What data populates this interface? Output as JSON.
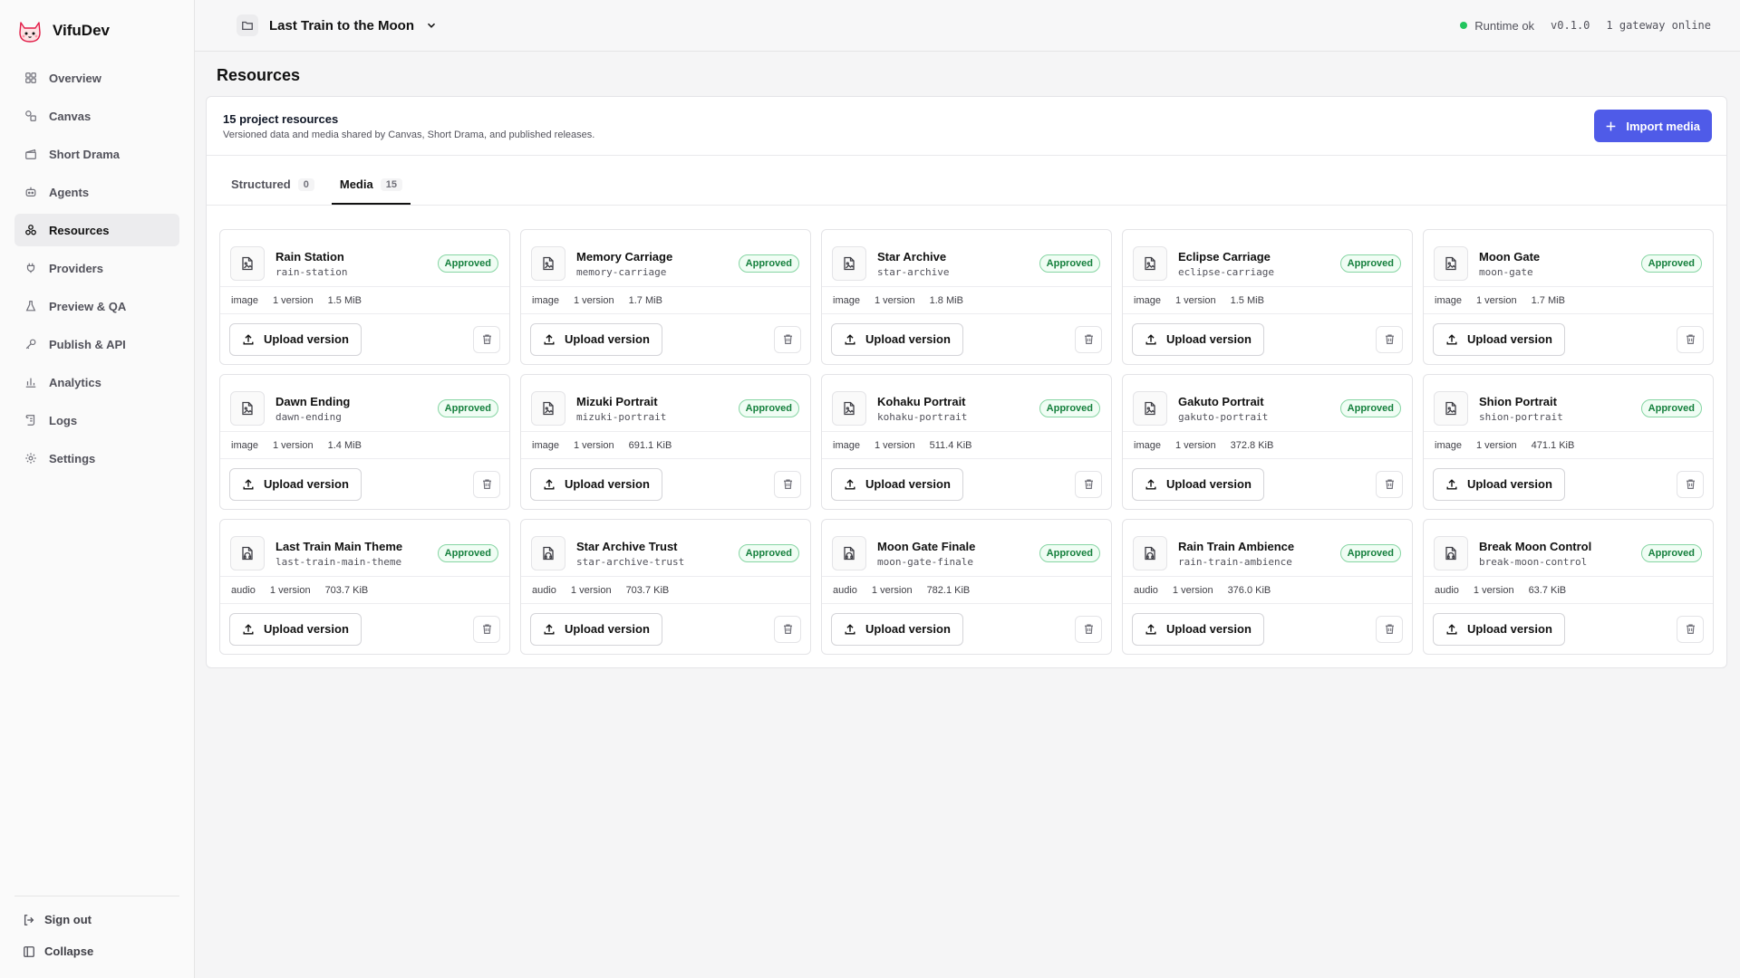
{
  "app": {
    "name": "VifuDev",
    "logo_icon": "cat-logo-icon"
  },
  "sidebar": {
    "items": [
      {
        "label": "Overview",
        "icon": "grid-icon",
        "active": false
      },
      {
        "label": "Canvas",
        "icon": "shapes-icon",
        "active": false
      },
      {
        "label": "Short Drama",
        "icon": "clapperboard-icon",
        "active": false
      },
      {
        "label": "Agents",
        "icon": "bot-icon",
        "active": false
      },
      {
        "label": "Resources",
        "icon": "boxes-icon",
        "active": true
      },
      {
        "label": "Providers",
        "icon": "plug-icon",
        "active": false
      },
      {
        "label": "Preview & QA",
        "icon": "flask-icon",
        "active": false
      },
      {
        "label": "Publish & API",
        "icon": "key-icon",
        "active": false
      },
      {
        "label": "Analytics",
        "icon": "bar-chart-icon",
        "active": false
      },
      {
        "label": "Logs",
        "icon": "scroll-icon",
        "active": false
      },
      {
        "label": "Settings",
        "icon": "gear-icon",
        "active": false
      }
    ],
    "sign_out": "Sign out",
    "collapse": "Collapse"
  },
  "header": {
    "project_name": "Last Train to the Moon",
    "runtime_status": "Runtime ok",
    "version": "v0.1.0",
    "gateway": "1 gateway online",
    "status_color": "#22c55e"
  },
  "page": {
    "title": "Resources",
    "panel_title": "15 project resources",
    "panel_subtitle": "Versioned data and media shared by Canvas, Short Drama, and published releases.",
    "import_button": "Import media",
    "accent_color": "#4f5be8",
    "tabs": [
      {
        "label": "Structured",
        "count": "0",
        "active": false
      },
      {
        "label": "Media",
        "count": "15",
        "active": true
      }
    ]
  },
  "resources": [
    {
      "name": "Rain Station",
      "slug": "rain-station",
      "status": "Approved",
      "type": "image",
      "versions": "1 version",
      "size": "1.5 MiB"
    },
    {
      "name": "Memory Carriage",
      "slug": "memory-carriage",
      "status": "Approved",
      "type": "image",
      "versions": "1 version",
      "size": "1.7 MiB"
    },
    {
      "name": "Star Archive",
      "slug": "star-archive",
      "status": "Approved",
      "type": "image",
      "versions": "1 version",
      "size": "1.8 MiB"
    },
    {
      "name": "Eclipse Carriage",
      "slug": "eclipse-carriage",
      "status": "Approved",
      "type": "image",
      "versions": "1 version",
      "size": "1.5 MiB"
    },
    {
      "name": "Moon Gate",
      "slug": "moon-gate",
      "status": "Approved",
      "type": "image",
      "versions": "1 version",
      "size": "1.7 MiB"
    },
    {
      "name": "Dawn Ending",
      "slug": "dawn-ending",
      "status": "Approved",
      "type": "image",
      "versions": "1 version",
      "size": "1.4 MiB"
    },
    {
      "name": "Mizuki Portrait",
      "slug": "mizuki-portrait",
      "status": "Approved",
      "type": "image",
      "versions": "1 version",
      "size": "691.1 KiB"
    },
    {
      "name": "Kohaku Portrait",
      "slug": "kohaku-portrait",
      "status": "Approved",
      "type": "image",
      "versions": "1 version",
      "size": "511.4 KiB"
    },
    {
      "name": "Gakuto Portrait",
      "slug": "gakuto-portrait",
      "status": "Approved",
      "type": "image",
      "versions": "1 version",
      "size": "372.8 KiB"
    },
    {
      "name": "Shion Portrait",
      "slug": "shion-portrait",
      "status": "Approved",
      "type": "image",
      "versions": "1 version",
      "size": "471.1 KiB"
    },
    {
      "name": "Last Train Main Theme",
      "slug": "last-train-main-theme",
      "status": "Approved",
      "type": "audio",
      "versions": "1 version",
      "size": "703.7 KiB"
    },
    {
      "name": "Star Archive Trust",
      "slug": "star-archive-trust",
      "status": "Approved",
      "type": "audio",
      "versions": "1 version",
      "size": "703.7 KiB"
    },
    {
      "name": "Moon Gate Finale",
      "slug": "moon-gate-finale",
      "status": "Approved",
      "type": "audio",
      "versions": "1 version",
      "size": "782.1 KiB"
    },
    {
      "name": "Rain Train Ambience",
      "slug": "rain-train-ambience",
      "status": "Approved",
      "type": "audio",
      "versions": "1 version",
      "size": "376.0 KiB"
    },
    {
      "name": "Break Moon Control",
      "slug": "break-moon-control",
      "status": "Approved",
      "type": "audio",
      "versions": "1 version",
      "size": "63.7 KiB"
    }
  ],
  "card_actions": {
    "upload_label": "Upload version",
    "delete_icon": "trash-icon"
  }
}
